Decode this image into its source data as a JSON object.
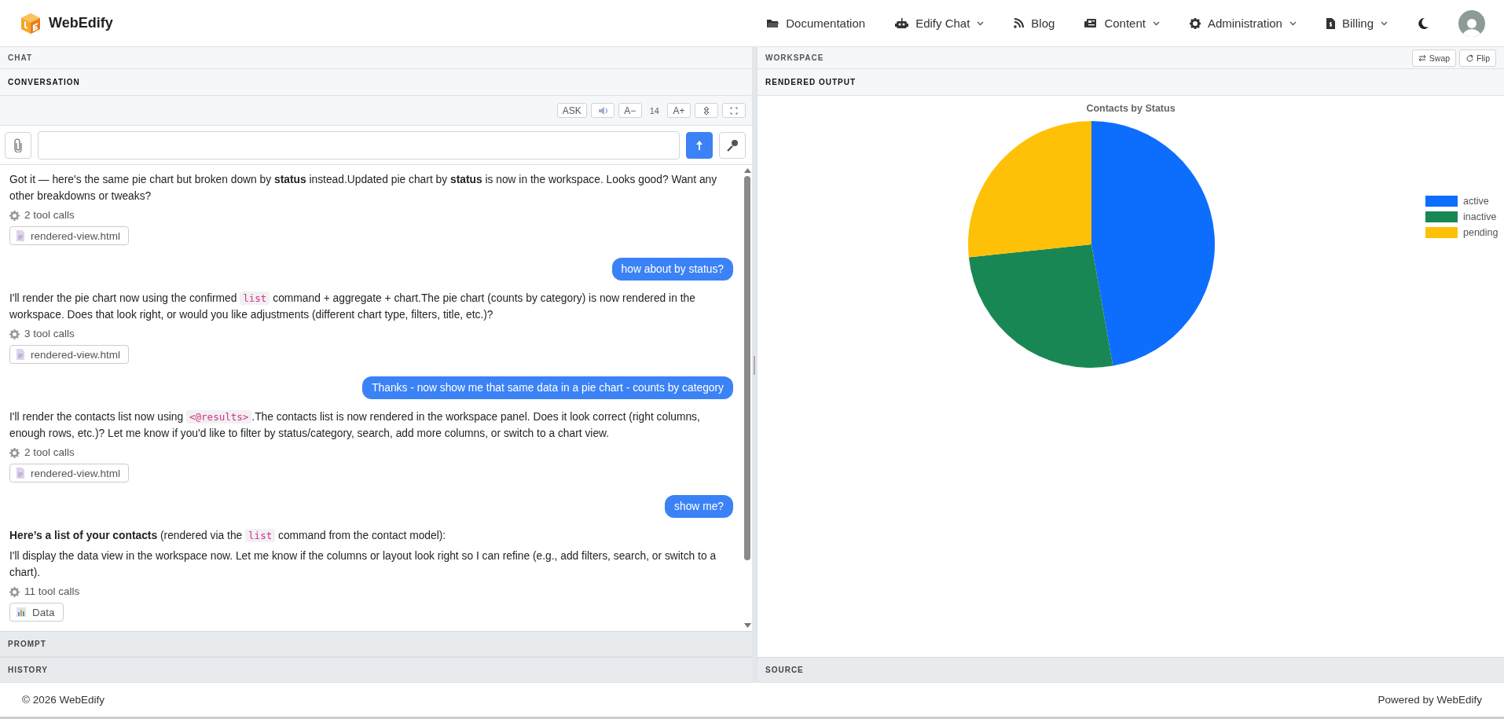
{
  "brand": {
    "name": "WebEdify"
  },
  "nav": [
    {
      "label": "Documentation",
      "dropdown": false
    },
    {
      "label": "Edify Chat",
      "dropdown": true
    },
    {
      "label": "Blog",
      "dropdown": false
    },
    {
      "label": "Content",
      "dropdown": true
    },
    {
      "label": "Administration",
      "dropdown": true
    },
    {
      "label": "Billing",
      "dropdown": true
    }
  ],
  "chat": {
    "header": "CHAT",
    "section": "CONVERSATION",
    "toolbar": [
      {
        "kind": "button",
        "label": "ASK"
      },
      {
        "kind": "speaker"
      },
      {
        "kind": "button",
        "label": "A−"
      },
      {
        "kind": "text",
        "label": "14"
      },
      {
        "kind": "button",
        "label": "A+"
      },
      {
        "kind": "updown"
      },
      {
        "kind": "fullscreen"
      }
    ],
    "messages": [
      {
        "kind": "assistant",
        "paragraphs": [
          [
            {
              "kind": "text",
              "text": "Got it — here's the same pie chart but broken down by **status** instead.Updated pie chart by **status** is now in the workspace. Looks good? Want any other breakdowns or tweaks?"
            }
          ]
        ],
        "tool_calls": "2 tool calls",
        "attachment": {
          "label": "rendered-view.html",
          "kind": "file"
        }
      },
      {
        "kind": "user",
        "text": "how about by status?"
      },
      {
        "kind": "assistant",
        "paragraphs": [
          [
            {
              "kind": "text",
              "text": "I'll render the pie chart now using the confirmed "
            },
            {
              "kind": "code",
              "text": "list"
            },
            {
              "kind": "text",
              "text": " command + aggregate + chart.The pie chart (counts by category) is now rendered in the workspace. Does that look right, or would you like adjustments (different chart type, filters, title, etc.)?"
            }
          ]
        ],
        "tool_calls": "3 tool calls",
        "attachment": {
          "label": "rendered-view.html",
          "kind": "file"
        }
      },
      {
        "kind": "user",
        "text": "Thanks - now show me that same data in a pie chart - counts by category"
      },
      {
        "kind": "assistant",
        "paragraphs": [
          [
            {
              "kind": "text",
              "text": "I'll render the contacts list now using "
            },
            {
              "kind": "code",
              "text": "<@results>"
            },
            {
              "kind": "text",
              "text": ".The contacts list is now rendered in the workspace panel. Does it look correct (right columns, enough rows, etc.)? Let me know if you'd like to filter by status/category, search, add more columns, or switch to a chart view."
            }
          ]
        ],
        "tool_calls": "2 tool calls",
        "attachment": {
          "label": "rendered-view.html",
          "kind": "file"
        }
      },
      {
        "kind": "user",
        "text": "show me?"
      },
      {
        "kind": "assistant",
        "paragraphs": [
          [
            {
              "kind": "text",
              "text": "**Here’s a list of your contacts** (rendered via the "
            },
            {
              "kind": "code",
              "text": "list"
            },
            {
              "kind": "text",
              "text": " command from the contact model):"
            }
          ],
          [
            {
              "kind": "text",
              "text": "I'll display the data view in the workspace now. Let me know if the columns or layout look right so I can refine (e.g., add filters, search, or switch to a chart)."
            }
          ]
        ],
        "tool_calls": "11 tool calls",
        "attachment": {
          "label": "Data",
          "kind": "chart"
        }
      }
    ],
    "footer_sections": [
      "PROMPT",
      "HISTORY"
    ]
  },
  "workspace": {
    "header": "WORKSPACE",
    "buttons": [
      {
        "label": "Swap"
      },
      {
        "label": "Flip"
      }
    ],
    "section": "RENDERED OUTPUT",
    "chart": {
      "title": "Contacts by Status",
      "legend": [
        {
          "label": "active",
          "color": "#0d6efd"
        },
        {
          "label": "inactive",
          "color": "#198754"
        },
        {
          "label": "pending",
          "color": "#ffc107"
        }
      ]
    },
    "footer_section": "SOURCE"
  },
  "footer": {
    "copyright": "© 2026 WebEdify",
    "powered": "Powered by WebEdify"
  }
}
